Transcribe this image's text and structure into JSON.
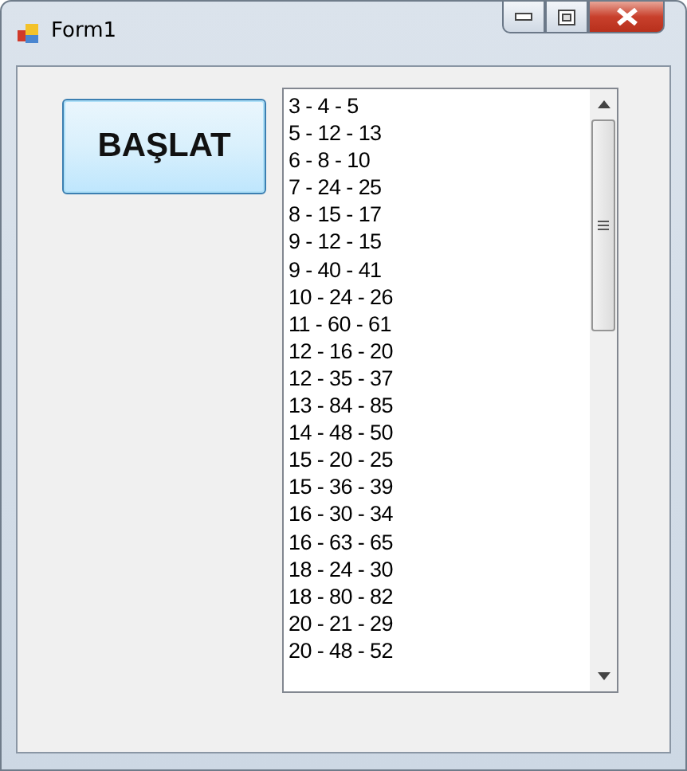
{
  "window": {
    "title": "Form1"
  },
  "start_button": {
    "label": "BAŞLAT"
  },
  "listbox": {
    "items": [
      "3 - 4 - 5",
      "5 - 12 - 13",
      "6 - 8 - 10",
      "7 - 24 - 25",
      "8 - 15 - 17",
      "9 - 12 - 15",
      "9 - 40 - 41",
      "10 - 24 - 26",
      "11 - 60 - 61",
      "12 - 16 - 20",
      "12 - 35 - 37",
      "13 - 84 - 85",
      "14 - 48 - 50",
      "15 - 20 - 25",
      "15 - 36 - 39",
      "16 - 30 - 34",
      "16 - 63 - 65",
      "18 - 24 - 30",
      "18 - 80 - 82",
      "20 - 21 - 29",
      "20 - 48 - 52"
    ]
  }
}
